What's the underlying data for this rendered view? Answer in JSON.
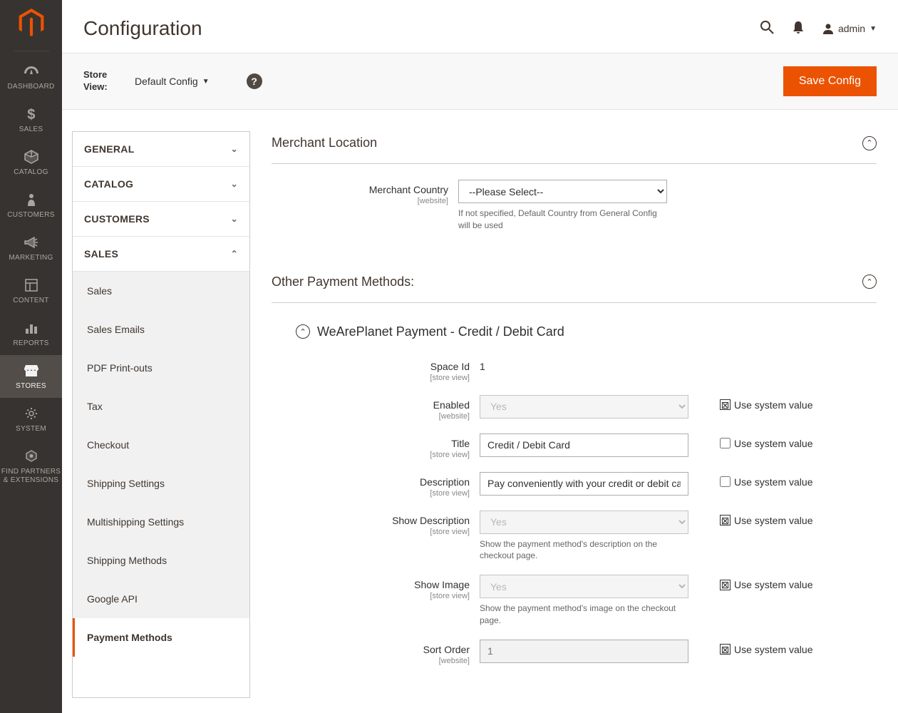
{
  "sidebar": {
    "items": [
      {
        "label": "DASHBOARD"
      },
      {
        "label": "SALES"
      },
      {
        "label": "CATALOG"
      },
      {
        "label": "CUSTOMERS"
      },
      {
        "label": "MARKETING"
      },
      {
        "label": "CONTENT"
      },
      {
        "label": "REPORTS"
      },
      {
        "label": "STORES"
      },
      {
        "label": "SYSTEM"
      },
      {
        "label": "FIND PARTNERS\n& EXTENSIONS"
      }
    ]
  },
  "header": {
    "title": "Configuration",
    "user": "admin"
  },
  "toolbar": {
    "store_view_label": "Store View:",
    "store_view_value": "Default Config",
    "save_label": "Save Config"
  },
  "tabs": {
    "general_label": "GENERAL",
    "catalog_label": "CATALOG",
    "customers_label": "CUSTOMERS",
    "sales_label": "SALES",
    "sales_items": [
      "Sales",
      "Sales Emails",
      "PDF Print-outs",
      "Tax",
      "Checkout",
      "Shipping Settings",
      "Multishipping Settings",
      "Shipping Methods",
      "Google API",
      "Payment Methods"
    ]
  },
  "panel": {
    "merchant_location_title": "Merchant Location",
    "merchant_country_label": "Merchant Country",
    "merchant_country_scope": "[website]",
    "merchant_country_value": "--Please Select--",
    "merchant_country_hint": "If not specified, Default Country from General Config will be used",
    "other_payments_title": "Other Payment Methods:",
    "pm_title": "WeArePlanet Payment - Credit / Debit Card",
    "use_system_value_label": "Use system value",
    "fields": {
      "space_id": {
        "label": "Space Id",
        "scope": "[store view]",
        "value": "1"
      },
      "enabled": {
        "label": "Enabled",
        "scope": "[website]",
        "value": "Yes",
        "use_system": true
      },
      "title": {
        "label": "Title",
        "scope": "[store view]",
        "value": "Credit / Debit Card",
        "use_system": false
      },
      "description": {
        "label": "Description",
        "scope": "[store view]",
        "value": "Pay conveniently with your credit or debit card.",
        "use_system": false
      },
      "show_description": {
        "label": "Show Description",
        "scope": "[store view]",
        "value": "Yes",
        "hint": "Show the payment method's description on the checkout page.",
        "use_system": true
      },
      "show_image": {
        "label": "Show Image",
        "scope": "[store view]",
        "value": "Yes",
        "hint": "Show the payment method's image on the checkout page.",
        "use_system": true
      },
      "sort_order": {
        "label": "Sort Order",
        "scope": "[website]",
        "value": "1",
        "use_system": true
      }
    }
  }
}
